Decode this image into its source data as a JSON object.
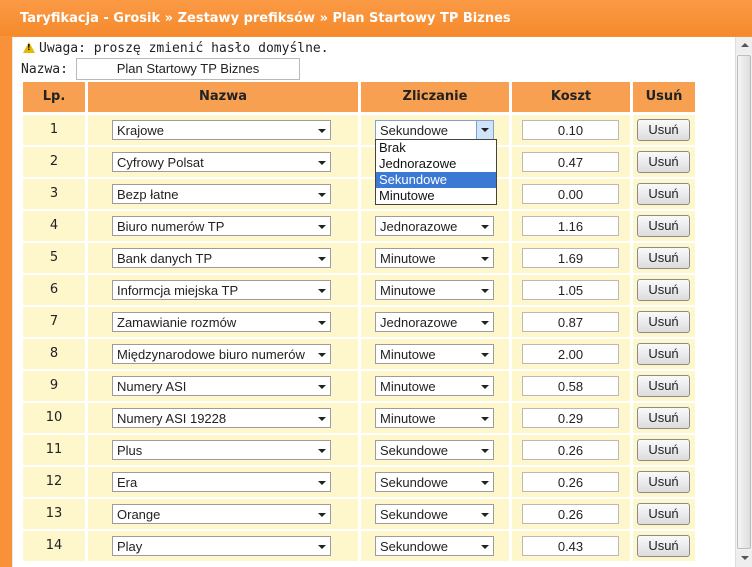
{
  "breadcrumb": "Taryfikacja - Grosik » Zestawy prefiksów » Plan Startowy TP Biznes",
  "warning": "Uwaga: proszę zmienić hasło domyślne.",
  "name_label": "Nazwa:",
  "name_value": "Plan Startowy TP Biznes",
  "columns": [
    "Lp.",
    "Nazwa",
    "Zliczanie",
    "Koszt",
    "Usuń"
  ],
  "rows": [
    {
      "lp": "1",
      "nazwa": "Krajowe",
      "zliczanie": "Sekundowe",
      "koszt": "0.10",
      "usun": "Usuń"
    },
    {
      "lp": "2",
      "nazwa": "Cyfrowy Polsat",
      "zliczanie": "",
      "koszt": "0.47",
      "usun": "Usuń"
    },
    {
      "lp": "3",
      "nazwa": "Bezp łatne",
      "zliczanie": "",
      "koszt": "0.00",
      "usun": "Usuń"
    },
    {
      "lp": "4",
      "nazwa": "Biuro numerów TP",
      "zliczanie": "Jednorazowe",
      "koszt": "1.16",
      "usun": "Usuń"
    },
    {
      "lp": "5",
      "nazwa": "Bank danych TP",
      "zliczanie": "Minutowe",
      "koszt": "1.69",
      "usun": "Usuń"
    },
    {
      "lp": "6",
      "nazwa": "Informcja miejska TP",
      "zliczanie": "Minutowe",
      "koszt": "1.05",
      "usun": "Usuń"
    },
    {
      "lp": "7",
      "nazwa": "Zamawianie rozmów",
      "zliczanie": "Jednorazowe",
      "koszt": "0.87",
      "usun": "Usuń"
    },
    {
      "lp": "8",
      "nazwa": "Międzynarodowe biuro numerów",
      "zliczanie": "Minutowe",
      "koszt": "2.00",
      "usun": "Usuń"
    },
    {
      "lp": "9",
      "nazwa": "Numery ASI",
      "zliczanie": "Minutowe",
      "koszt": "0.58",
      "usun": "Usuń"
    },
    {
      "lp": "10",
      "nazwa": "Numery ASI 19228",
      "zliczanie": "Minutowe",
      "koszt": "0.29",
      "usun": "Usuń"
    },
    {
      "lp": "11",
      "nazwa": "Plus",
      "zliczanie": "Sekundowe",
      "koszt": "0.26",
      "usun": "Usuń"
    },
    {
      "lp": "12",
      "nazwa": "Era",
      "zliczanie": "Sekundowe",
      "koszt": "0.26",
      "usun": "Usuń"
    },
    {
      "lp": "13",
      "nazwa": "Orange",
      "zliczanie": "Sekundowe",
      "koszt": "0.26",
      "usun": "Usuń"
    },
    {
      "lp": "14",
      "nazwa": "Play",
      "zliczanie": "Sekundowe",
      "koszt": "0.43",
      "usun": "Usuń"
    }
  ],
  "dropdown": {
    "options": [
      "Brak",
      "Jednorazowe",
      "Sekundowe",
      "Minutowe"
    ],
    "highlighted": "Sekundowe"
  },
  "colors": {
    "header_bg": "#f7923b",
    "column_header": "#f7a052",
    "row_bg": "#fff7cc",
    "highlight": "#3b79d4"
  },
  "icons": [
    "warning-icon",
    "chevron-down-icon"
  ]
}
